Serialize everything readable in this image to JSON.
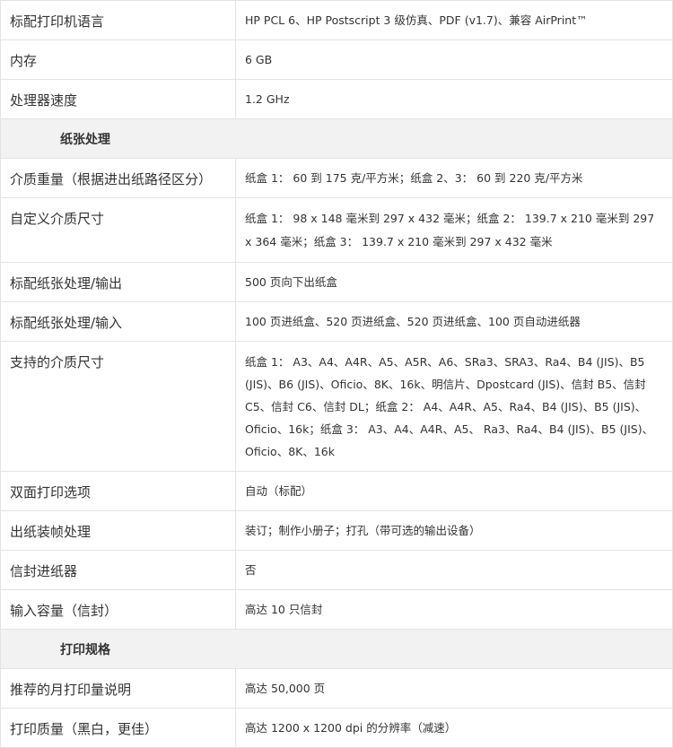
{
  "rows": [
    {
      "type": "row",
      "label": "标配打印机语言",
      "value": "HP PCL 6、HP Postscript 3 级仿真、PDF (v1.7)、兼容 AirPrint™"
    },
    {
      "type": "row",
      "label": "内存",
      "value": "6 GB"
    },
    {
      "type": "row",
      "label": "处理器速度",
      "value": "1.2 GHz"
    },
    {
      "type": "section",
      "label": "纸张处理"
    },
    {
      "type": "row",
      "label": "介质重量（根据进出纸路径区分）",
      "value": "纸盒 1： 60 到 175 克/平方米；纸盒 2、3： 60 到 220 克/平方米"
    },
    {
      "type": "row",
      "label": "自定义介质尺寸",
      "value": "纸盒 1： 98 x 148 毫米到 297 x 432 毫米；纸盒 2： 139.7 x 210 毫米到 297 x 364 毫米；纸盒 3： 139.7 x 210 毫米到 297 x 432 毫米"
    },
    {
      "type": "row",
      "label": "标配纸张处理/输出",
      "value": "500 页向下出纸盒"
    },
    {
      "type": "row",
      "label": "标配纸张处理/输入",
      "value": "100 页进纸盒、520 页进纸盒、520 页进纸盒、100 页自动进纸器"
    },
    {
      "type": "row",
      "label": "支持的介质尺寸",
      "value": "纸盒 1： A3、A4、A4R、A5、A5R、A6、SRa3、SRA3、Ra4、B4 (JIS)、B5 (JIS)、B6 (JIS)、Oficio、8K、16k、明信片、Dpostcard (JIS)、信封 B5、信封 C5、信封 C6、信封 DL；纸盒 2： A4、A4R、A5、Ra4、B4 (JIS)、B5 (JIS)、Oficio、16k；纸盒 3： A3、A4、A4R、A5、 Ra3、Ra4、B4 (JIS)、B5 (JIS)、Oficio、8K、16k"
    },
    {
      "type": "row",
      "label": "双面打印选项",
      "value": "自动（标配）"
    },
    {
      "type": "row",
      "label": "出纸装帧处理",
      "value": "装订；制作小册子；打孔（带可选的输出设备）"
    },
    {
      "type": "row",
      "label": "信封进纸器",
      "value": "否"
    },
    {
      "type": "row",
      "label": "输入容量（信封）",
      "value": "高达 10 只信封"
    },
    {
      "type": "section",
      "label": "打印规格"
    },
    {
      "type": "row",
      "label": "推荐的月打印量说明",
      "value": "高达 50,000 页"
    },
    {
      "type": "row",
      "label": "打印质量（黑白，更佳）",
      "value": "高达 1200 x 1200 dpi 的分辨率（减速）"
    }
  ]
}
